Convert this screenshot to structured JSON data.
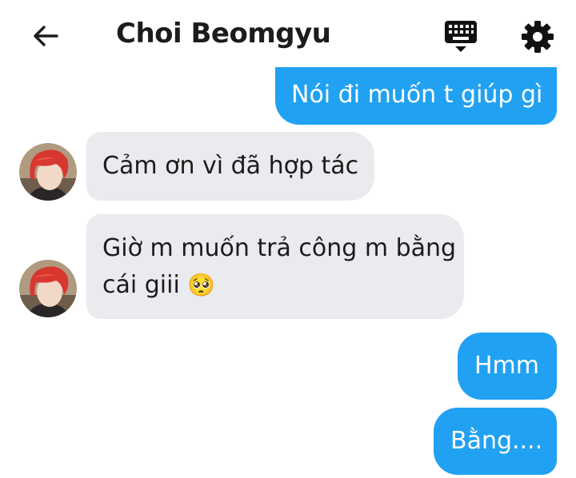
{
  "header": {
    "title": "Choi Beomgyu",
    "icons": {
      "back": "arrow-left-icon",
      "keyboard": "keyboard-icon",
      "settings": "gear-icon"
    }
  },
  "colors": {
    "outgoing_bubble": "#21a1f1",
    "incoming_bubble": "#e9ebee",
    "text_dark": "#1c1c1c"
  },
  "messages": [
    {
      "sender": "me",
      "text": "Nói đi muốn t giúp gì"
    },
    {
      "sender": "Choi Beomgyu",
      "text": "Cảm ơn vì đã hợp tác"
    },
    {
      "sender": "Choi Beomgyu",
      "line1": "Giờ m muốn trả công m bằng",
      "line2": "cái giii",
      "emoji": "🥺"
    },
    {
      "sender": "me",
      "text": "Hmm"
    },
    {
      "sender": "me",
      "text": "Bằng...."
    }
  ]
}
